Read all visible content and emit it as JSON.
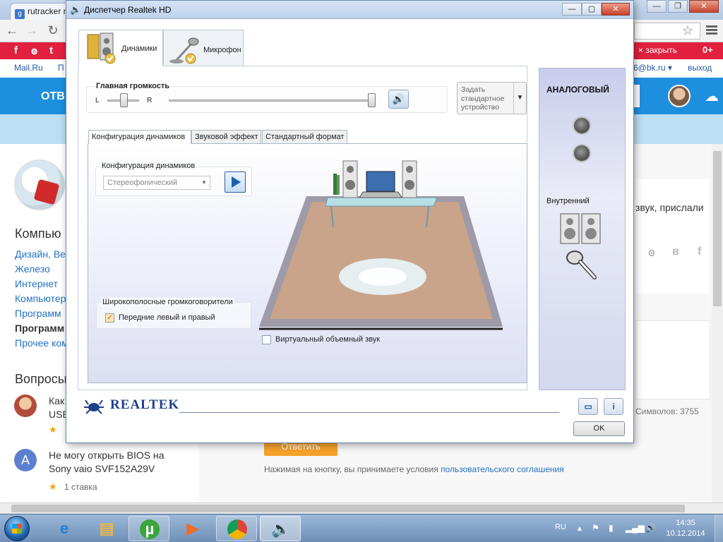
{
  "browser": {
    "tab_title": "rutracker n",
    "social_icons": [
      "f",
      "ok",
      "tw"
    ],
    "close_ads": "× закрыть",
    "red_plus": "0+",
    "mail_link": "Mail.Ru",
    "mail_nav_fragment": "П",
    "mail_email_fragment": "6@bk.ru ▾",
    "mail_exit": "выход",
    "header_fragment": "ОТВ",
    "categories_title": "Компью",
    "categories": [
      "Дизайн, Ве",
      "Железо",
      "Интернет",
      "Компьютер",
      "Программ",
      "Программ",
      "Прочее ком"
    ],
    "questions_title": "Вопросы",
    "questions": [
      {
        "text_line1": "Как",
        "text_line2": "USB",
        "bets": ""
      },
      {
        "text_line1": "Не могу открыть BIOS на",
        "text_line2": "Sony vaio SVF152A29V",
        "bets": "1 ставка"
      }
    ],
    "right_text": "звук, прислали",
    "share_icons": [
      "ok",
      "в",
      "f"
    ],
    "symbol_count": "Символов: 3755",
    "answer_button": "Ответить",
    "agreement_text": "Нажимая на кнопку, вы принимаете условия ",
    "agreement_link": "пользовательского соглашения"
  },
  "dialog": {
    "title": "Диспетчер Realtek HD",
    "device_tabs": [
      "Динамики",
      "Микрофон"
    ],
    "main_volume_label": "Главная громкость",
    "left_label": "L",
    "right_label": "R",
    "default_device": "Задать стандартное устройство",
    "sub_tabs": [
      "Конфигурация динамиков",
      "Звуковой эффект",
      "Стандартный формат"
    ],
    "speaker_config_label": "Конфигурация динамиков",
    "speaker_config_value": "Стереофонический",
    "fullrange_label": "Широкополосные громкоговорители",
    "front_lr_label": "Передние левый и правый",
    "virtual_surround_label": "Виртуальный объемный звук",
    "analog_title": "АНАЛОГОВЫЙ",
    "internal_label": "Внутренний",
    "brand": "REALTEK",
    "ok_label": "OK",
    "front_lr_checked": true,
    "virtual_surround_checked": false,
    "balance_value": 0.5,
    "volume_value": 1.0
  },
  "taskbar": {
    "language": "RU",
    "time": "14:35",
    "date": "10.12.2014"
  }
}
